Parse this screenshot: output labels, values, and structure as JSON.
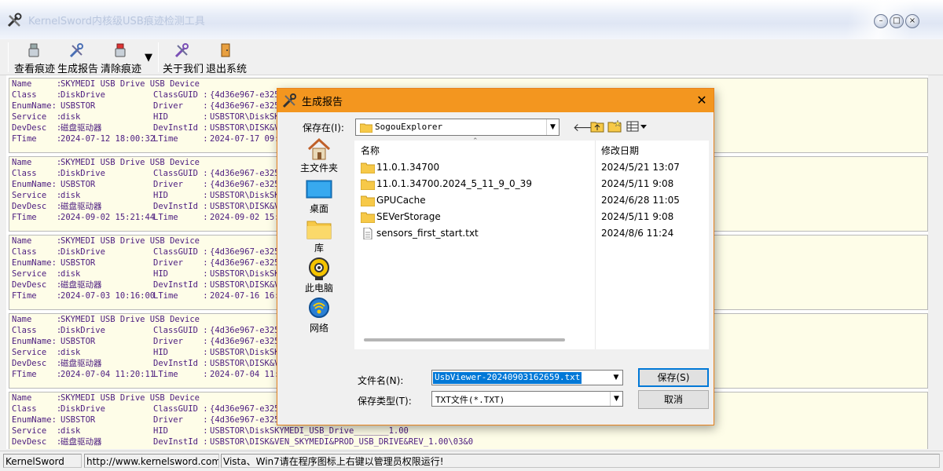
{
  "window": {
    "title": "KernelSword内核级USB痕迹检测工具"
  },
  "toolbar": {
    "view_traces": "查看痕迹",
    "generate_report": "生成报告",
    "clear_traces": "清除痕迹",
    "about_us": "关于我们",
    "exit_system": "退出系统"
  },
  "devices": [
    {
      "name": "SKYMEDI USB Drive USB Device",
      "class": "DiskDrive",
      "class_guid": "{4d36e967-e325",
      "enum_name": "USBSTOR",
      "driver": "{4d36e967-e325",
      "service": "disk",
      "hid": "USBSTOR\\DiskSK",
      "dev_desc": "磁盘驱动器",
      "dev_inst_id": "USBSTOR\\DISK&V",
      "ftime": "2024-07-12 18:00:32",
      "ltime": "2024-07-17 09:"
    },
    {
      "name": "SKYMEDI USB Drive USB Device",
      "class": "DiskDrive",
      "class_guid": "{4d36e967-e325",
      "enum_name": "USBSTOR",
      "driver": "{4d36e967-e325",
      "service": "disk",
      "hid": "USBSTOR\\DiskSK",
      "dev_desc": "磁盘驱动器",
      "dev_inst_id": "USBSTOR\\DISK&V",
      "ftime": "2024-09-02 15:21:44",
      "ltime": "2024-09-02 15:"
    },
    {
      "name": "SKYMEDI USB Drive USB Device",
      "class": "DiskDrive",
      "class_guid": "{4d36e967-e325",
      "enum_name": "USBSTOR",
      "driver": "{4d36e967-e325",
      "service": "disk",
      "hid": "USBSTOR\\DiskSK",
      "dev_desc": "磁盘驱动器",
      "dev_inst_id": "USBSTOR\\DISK&V",
      "ftime": "2024-07-03 10:16:00",
      "ltime": "2024-07-16 16:"
    },
    {
      "name": "SKYMEDI USB Drive USB Device",
      "class": "DiskDrive",
      "class_guid": "{4d36e967-e325",
      "enum_name": "USBSTOR",
      "driver": "{4d36e967-e325",
      "service": "disk",
      "hid": "USBSTOR\\DiskSK",
      "dev_desc": "磁盘驱动器",
      "dev_inst_id": "USBSTOR\\DISK&V",
      "ftime": "2024-07-04 11:20:11",
      "ltime": "2024-07-04 11:"
    },
    {
      "name": "SKYMEDI USB Drive USB Device",
      "class": "DiskDrive",
      "class_guid": "{4d36e967-e325",
      "enum_name": "USBSTOR",
      "driver": "{4d36e967-e325",
      "service": "disk",
      "hid": "USBSTOR\\DiskSKYMEDI_USB_Drive_______1.00",
      "dev_desc": "磁盘驱动器",
      "dev_inst_id": "USBSTOR\\DISK&VEN_SKYMEDI&PROD_USB_DRIVE&REV_1.00\\03&0",
      "ftime": "",
      "ltime": ""
    }
  ],
  "keys": {
    "name": "Name     :",
    "class": "Class    :",
    "enum_name": "EnumName:",
    "service": "Service  :",
    "dev_desc": "DevDesc  :",
    "ftime": "FTime    :",
    "class_guid": "ClassGUID :",
    "driver": "Driver    :",
    "hid": "HID       :",
    "dev_inst_id": "DevInstId :",
    "ltime": "LTime     :"
  },
  "status": {
    "pane1": "KernelSword",
    "pane2": "http://www.kernelsword.com",
    "pane3": "Vista、Win7请在程序图标上右键以管理员权限运行!"
  },
  "dialog": {
    "title": "生成报告",
    "save_in_label": "保存在(I):",
    "save_in_value": "SogouExplorer",
    "places": [
      "主文件夹",
      "桌面",
      "库",
      "此电脑",
      "网络"
    ],
    "col_name": "名称",
    "col_modified": "修改日期",
    "files": [
      {
        "name": "11.0.1.34700",
        "date": "2024/5/21 13:07",
        "type": "folder"
      },
      {
        "name": "11.0.1.34700.2024_5_11_9_0_39",
        "date": "2024/5/11 9:08",
        "type": "folder"
      },
      {
        "name": "GPUCache",
        "date": "2024/6/28 11:05",
        "type": "folder"
      },
      {
        "name": "SEVerStorage",
        "date": "2024/5/11 9:08",
        "type": "folder"
      },
      {
        "name": "sensors_first_start.txt",
        "date": "2024/8/6 11:24",
        "type": "file"
      }
    ],
    "filename_label": "文件名(N):",
    "filename_value": "UsbViewer-20240903162659.txt",
    "filetype_label": "保存类型(T):",
    "filetype_value": "TXT文件(*.TXT)",
    "save_button": "保存(S)",
    "cancel_button": "取消"
  },
  "colors": {
    "dialog_title": "#f3961f",
    "card_bg": "#fefde8",
    "card_text": "#4b1b7f",
    "folder": "#f7c948",
    "selection": "#0078d7"
  }
}
